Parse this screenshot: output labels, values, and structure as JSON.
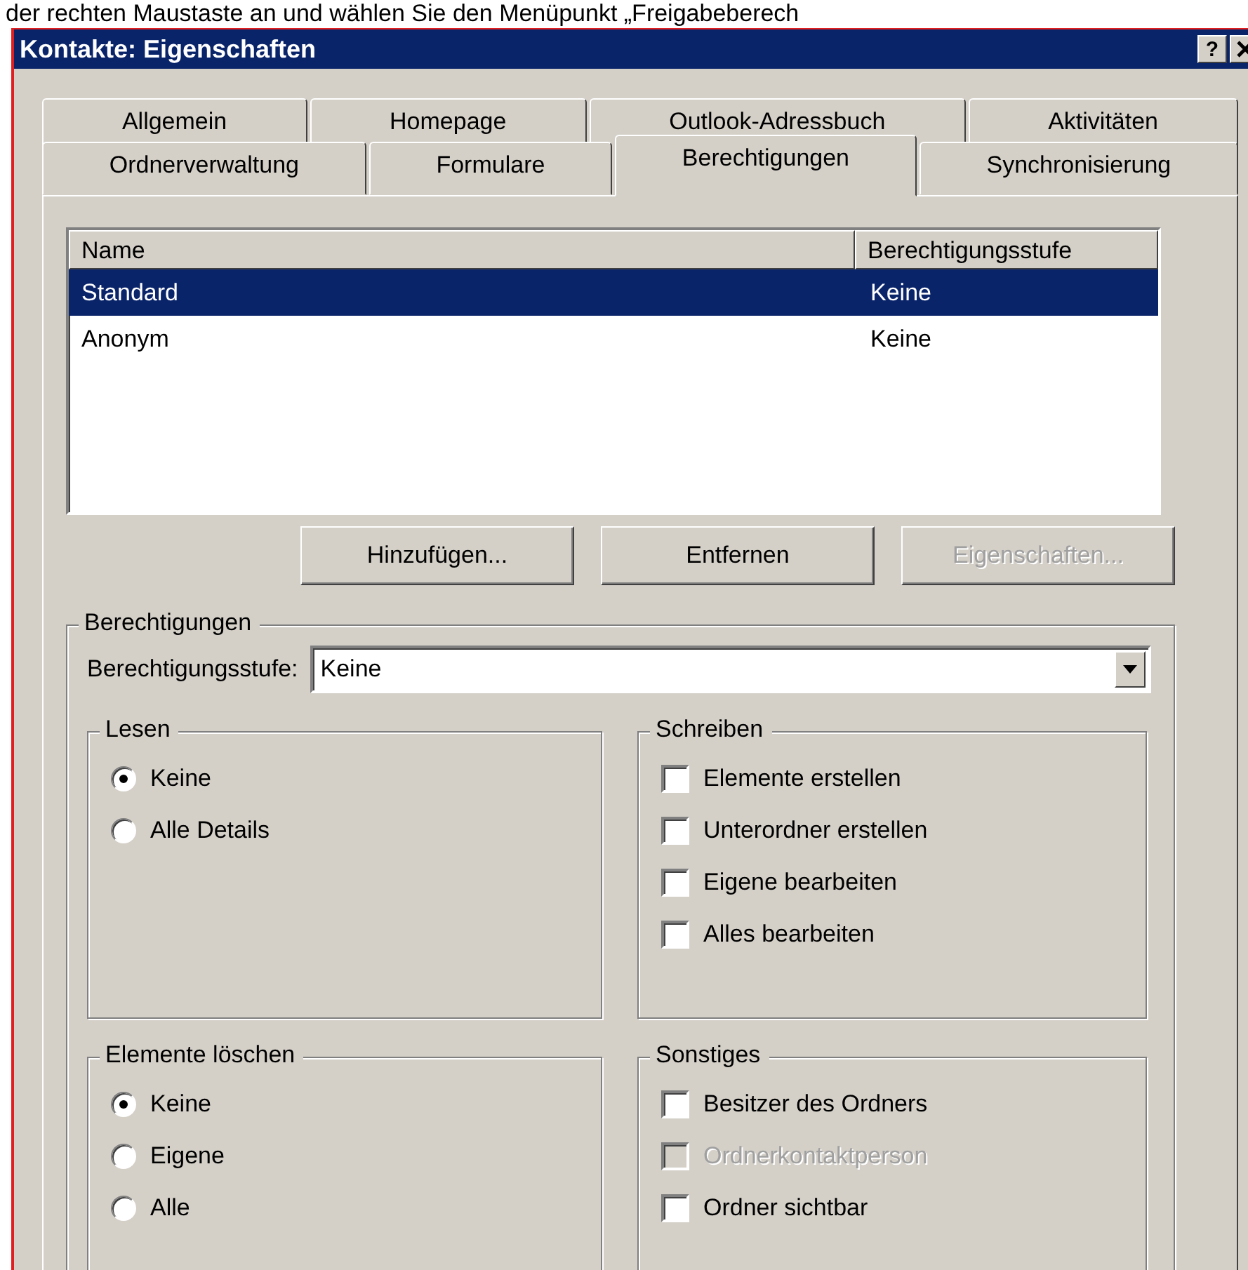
{
  "caption": "der rechten Maustaste an und wählen Sie den Menüpunkt „Freigabeberech",
  "window": {
    "title": "Kontakte: Eigenschaften",
    "help_button": "?"
  },
  "tab_rows": [
    [
      {
        "label": "Allgemein",
        "selected": false
      },
      {
        "label": "Homepage",
        "selected": false
      },
      {
        "label": "Outlook-Adressbuch",
        "selected": false
      },
      {
        "label": "Aktivitäten",
        "selected": false
      }
    ],
    [
      {
        "label": "Ordnerverwaltung",
        "selected": false
      },
      {
        "label": "Formulare",
        "selected": false
      },
      {
        "label": "Berechtigungen",
        "selected": true
      },
      {
        "label": "Synchronisierung",
        "selected": false
      }
    ]
  ],
  "permissions_list": {
    "columns": [
      "Name",
      "Berechtigungsstufe"
    ],
    "rows": [
      {
        "name": "Standard",
        "permission": "Keine",
        "selected": true
      },
      {
        "name": "Anonym",
        "permission": "Keine",
        "selected": false
      }
    ]
  },
  "buttons": [
    {
      "label": "Hinzufügen...",
      "disabled": false
    },
    {
      "label": "Entfernen",
      "disabled": false
    },
    {
      "label": "Eigenschaften...",
      "disabled": true
    }
  ],
  "permissions": {
    "title": "Berechtigungen",
    "level_label": "Berechtigungsstufe:",
    "level_value": "Keine",
    "sections": [
      {
        "title": "Lesen",
        "kind": "radio",
        "options": [
          {
            "label": "Keine",
            "selected": true
          },
          {
            "label": "Alle Details",
            "selected": false
          }
        ]
      },
      {
        "title": "Schreiben",
        "kind": "checkbox",
        "options": [
          {
            "label": "Elemente erstellen",
            "checked": false,
            "disabled": false
          },
          {
            "label": "Unterordner erstellen",
            "checked": false,
            "disabled": false
          },
          {
            "label": "Eigene bearbeiten",
            "checked": false,
            "disabled": false
          },
          {
            "label": "Alles bearbeiten",
            "checked": false,
            "disabled": false
          }
        ]
      },
      {
        "title": "Elemente löschen",
        "kind": "radio",
        "options": [
          {
            "label": "Keine",
            "selected": true
          },
          {
            "label": "Eigene",
            "selected": false
          },
          {
            "label": "Alle",
            "selected": false
          }
        ]
      },
      {
        "title": "Sonstiges",
        "kind": "checkbox",
        "options": [
          {
            "label": "Besitzer des Ordners",
            "checked": false,
            "disabled": false
          },
          {
            "label": "Ordnerkontaktperson",
            "checked": false,
            "disabled": true
          },
          {
            "label": "Ordner sichtbar",
            "checked": false,
            "disabled": false
          }
        ]
      }
    ]
  }
}
